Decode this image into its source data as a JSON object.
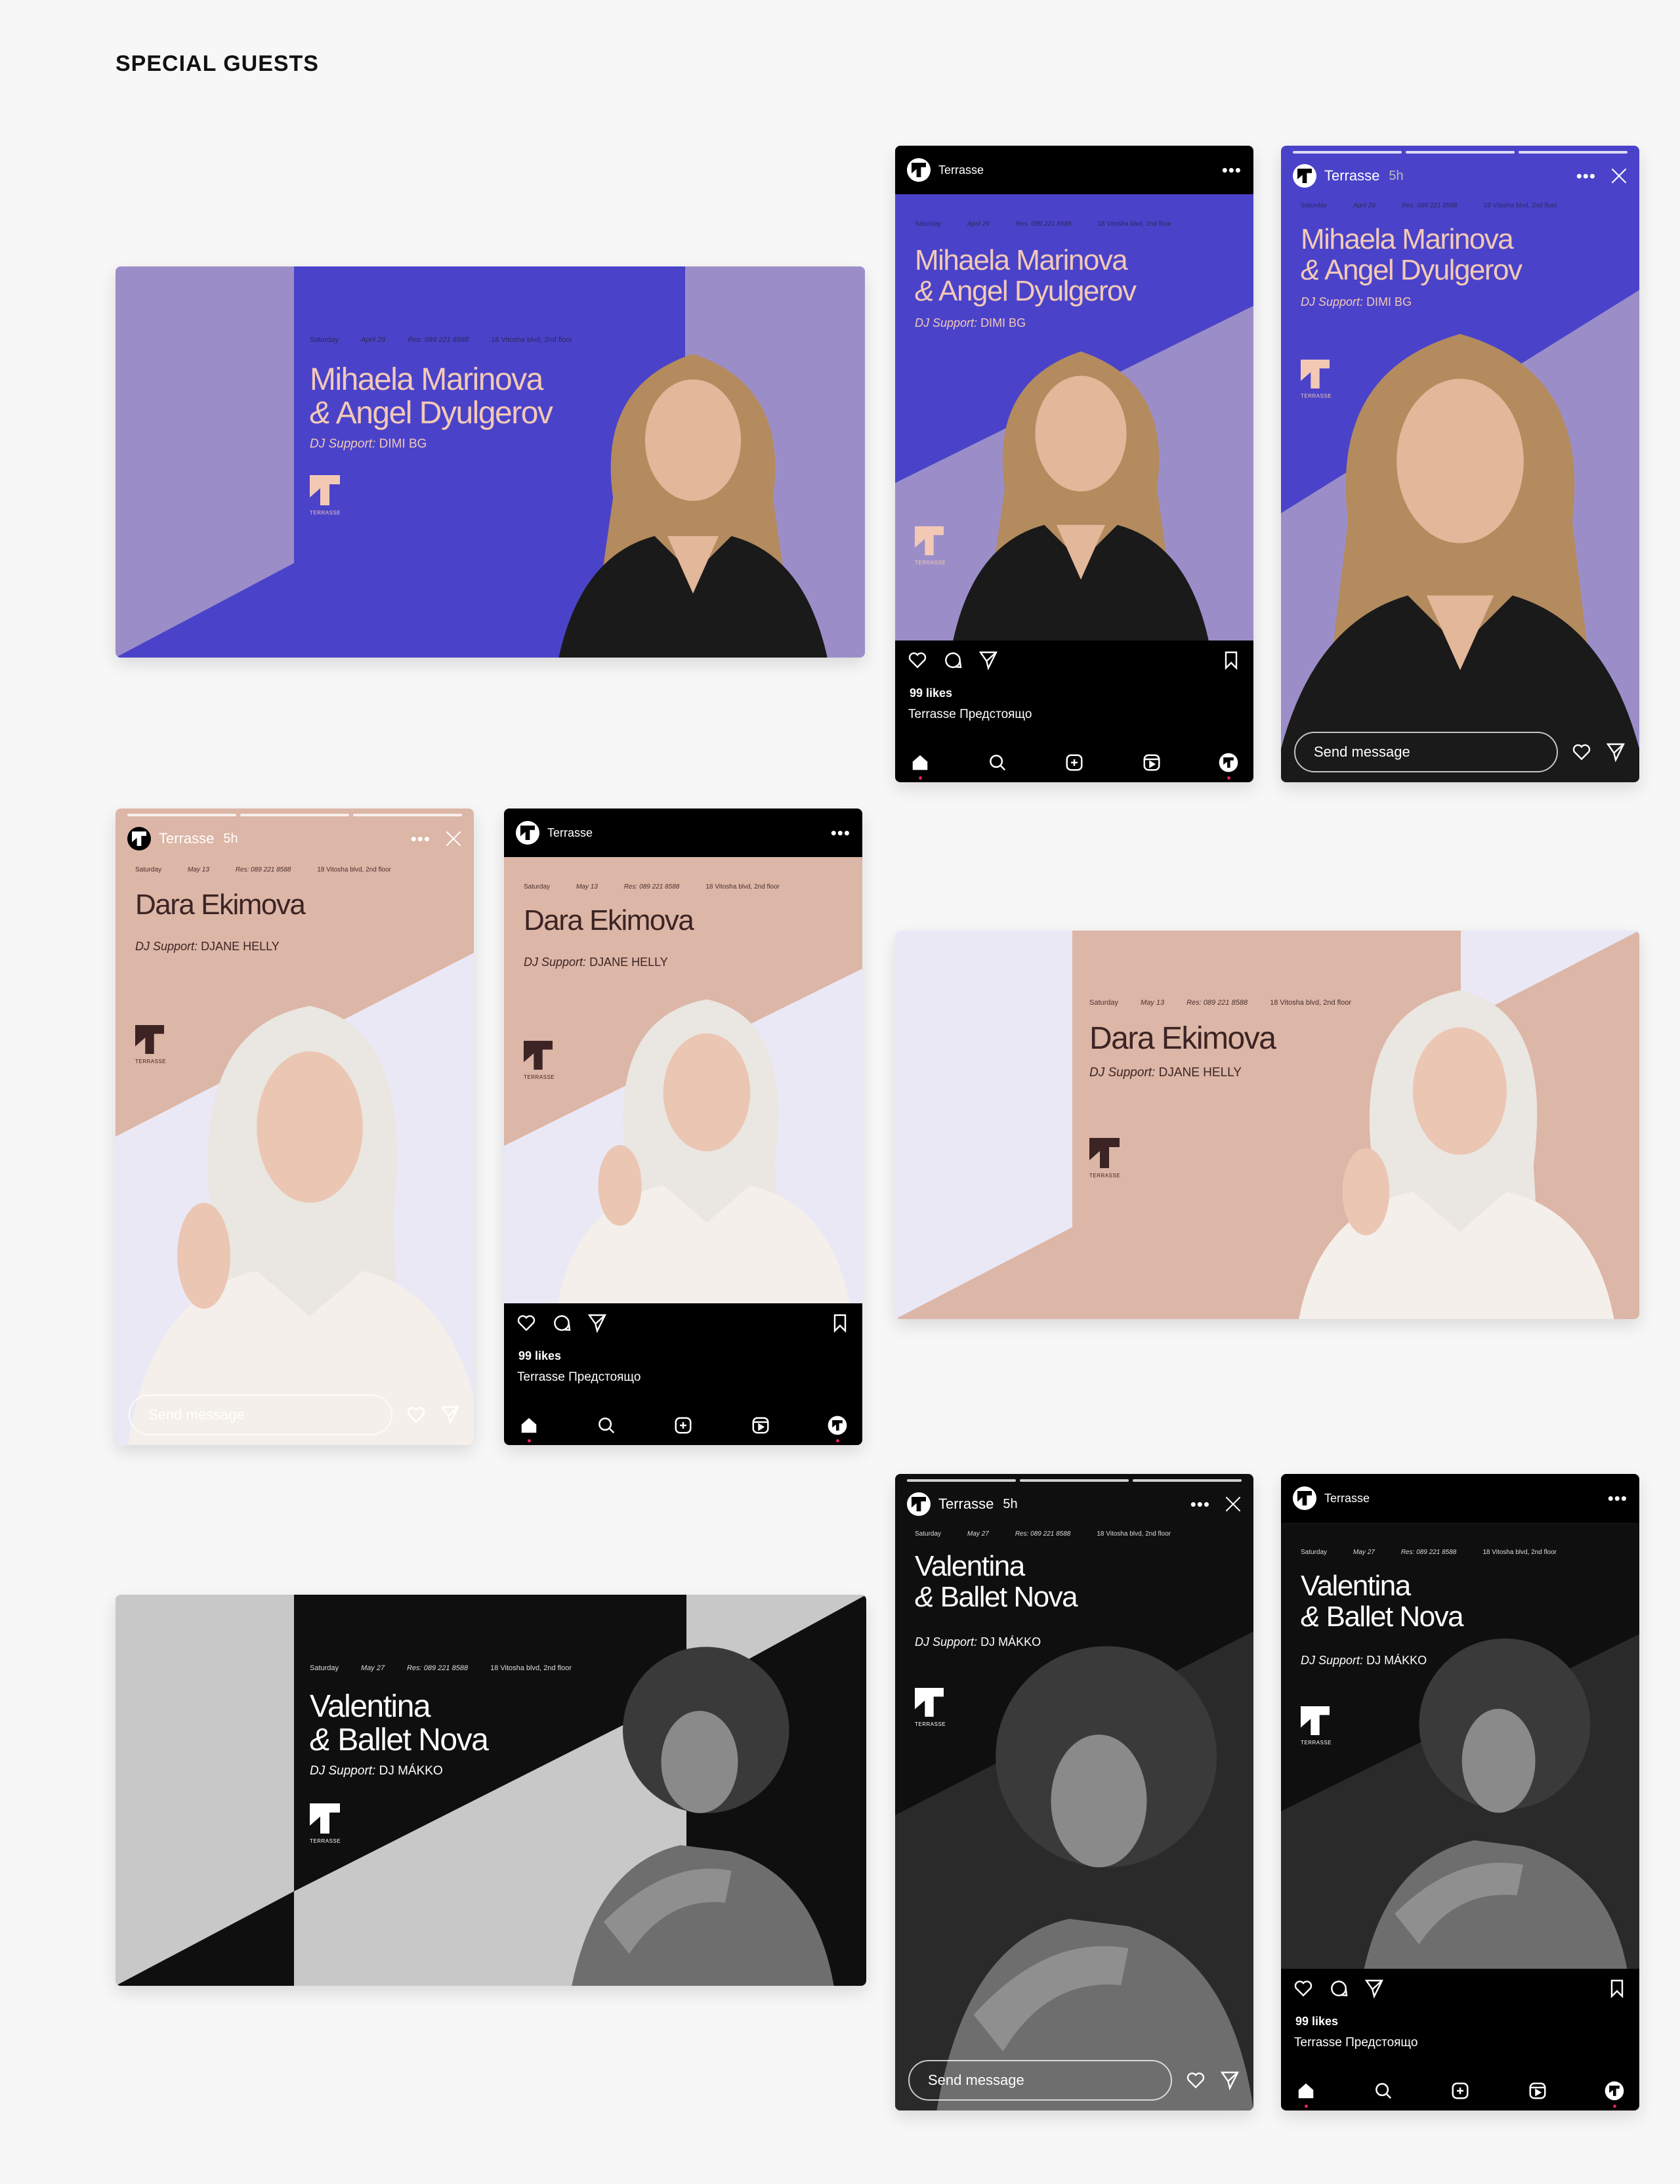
{
  "page": {
    "title": "SPECIAL GUESTS"
  },
  "brand": {
    "account": "Terrasse",
    "story_time": "5h",
    "logo_word": "TERRASSE"
  },
  "ig": {
    "likes": "99 likes",
    "caption": "Terrasse Предстоящо",
    "send_placeholder": "Send message",
    "menu": "•••"
  },
  "colors": {
    "purple": "#4a43c9",
    "lavender": "#9b8ec8",
    "pink": "#dcb6a6",
    "lilac": "#ebe8f6",
    "black": "#0f0f0f",
    "grey": "#c8c8c8"
  },
  "events": [
    {
      "id": "mihaela",
      "day": "Saturday",
      "date": "April 29",
      "res": "Res: 089 221 8588",
      "address": "18 Vitosha blvd, 2nd floor",
      "line1": "Mihaela Marinova",
      "line2_amp": "&",
      "line2": "Angel Dyulgerov",
      "support_label": "DJ Support:",
      "support_name": "DIMI BG"
    },
    {
      "id": "dara",
      "day": "Saturday",
      "date": "May 13",
      "res": "Res: 089 221 8588",
      "address": "18 Vitosha blvd, 2nd floor",
      "line1": "Dara Ekimova",
      "line2_amp": "",
      "line2": "",
      "support_label": "DJ Support:",
      "support_name": "DJANE HELLY"
    },
    {
      "id": "valentina",
      "day": "Saturday",
      "date": "May 27",
      "res": "Res: 089 221 8588",
      "address": "18 Vitosha blvd, 2nd floor",
      "line1": "Valentina",
      "line2_amp": "&",
      "line2": "Ballet Nova",
      "support_label": "DJ Support:",
      "support_name": "DJ MÁKKO"
    }
  ]
}
